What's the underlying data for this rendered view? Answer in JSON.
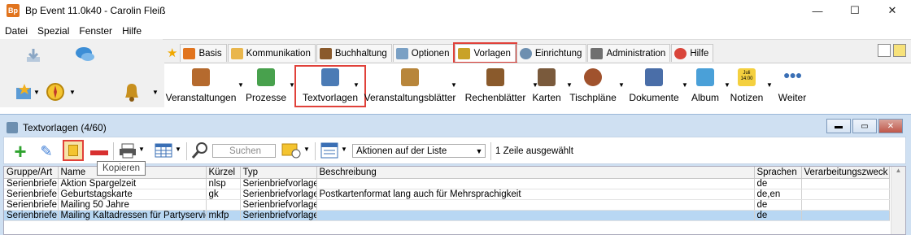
{
  "window": {
    "app_icon_text": "Bp",
    "title": "Bp Event 11.0k40 - Carolin Fleiß",
    "controls": {
      "minimize": "—",
      "maximize": "☐",
      "close": "✕"
    }
  },
  "menu": [
    "Datei",
    "Spezial",
    "Fenster",
    "Hilfe"
  ],
  "ribbon_tabs": [
    {
      "label": "Basis",
      "icon": "bp-icon",
      "color": "#e1741e"
    },
    {
      "label": "Kommunikation",
      "icon": "envelope-icon",
      "color": "#e9b64c"
    },
    {
      "label": "Buchhaltung",
      "icon": "accountant-icon",
      "color": "#8a5a2c"
    },
    {
      "label": "Optionen",
      "icon": "window-icon",
      "color": "#7aa0c4"
    },
    {
      "label": "Vorlagen",
      "icon": "template-icon",
      "color": "#c9a227",
      "active": true
    },
    {
      "label": "Einrichtung",
      "icon": "gear-icon",
      "color": "#6d8fb0"
    },
    {
      "label": "Administration",
      "icon": "tools-icon",
      "color": "#707070"
    },
    {
      "label": "Hilfe",
      "icon": "lifebuoy-icon",
      "color": "#d9453a"
    }
  ],
  "ribbon_tools": [
    {
      "label": "Veranstaltungen",
      "icon": "event-icon",
      "color": "#b56a2e"
    },
    {
      "label": "Prozesse",
      "icon": "process-icon",
      "color": "#48a14d"
    },
    {
      "label": "Textvorlagen",
      "icon": "text-template-icon",
      "color": "#4b7bb5",
      "selected": true
    },
    {
      "label": "Veranstaltungsblätter",
      "icon": "event-sheet-icon",
      "color": "#b8863b"
    },
    {
      "label": "Rechenblätter",
      "icon": "calc-sheet-icon",
      "color": "#8a5a2c"
    },
    {
      "label": "Karten",
      "icon": "cards-icon",
      "color": "#7a5a3c"
    },
    {
      "label": "Tischpläne",
      "icon": "table-plan-icon",
      "color": "#a0522d"
    },
    {
      "label": "Dokumente",
      "icon": "documents-icon",
      "color": "#4a6ea8"
    },
    {
      "label": "Album",
      "icon": "album-icon",
      "color": "#4aa0d8"
    },
    {
      "label": "Notizen",
      "icon": "notes-icon",
      "color": "#f4d03f"
    },
    {
      "label": "Weiter",
      "icon": "more-icon",
      "color": "#3a6fb5"
    }
  ],
  "notes_icon_text": "Juli 14:00",
  "subwindow": {
    "title": "Textvorlagen (4/60)",
    "search_placeholder": "Suchen",
    "actions_combo": "Aktionen auf der Liste",
    "selection_status": "1 Zeile ausgewählt",
    "tooltip": "Kopieren"
  },
  "table": {
    "columns": [
      "Gruppe/Art",
      "Name",
      "Kürzel",
      "Typ",
      "Beschreibung",
      "Sprachen",
      "Verarbeitungszweck"
    ],
    "rows": [
      [
        "Serienbriefe",
        "Aktion Spargelzeit",
        "nlsp",
        "Serienbriefvorlage",
        "",
        "de",
        ""
      ],
      [
        "Serienbriefe",
        "Geburtstagskarte",
        "gk",
        "Serienbriefvorlage",
        "Postkartenformat lang auch für Mehrsprachigkeit",
        "de,en",
        ""
      ],
      [
        "Serienbriefe",
        "Mailing 50 Jahre",
        "",
        "Serienbriefvorlage",
        "",
        "de",
        ""
      ],
      [
        "Serienbriefe",
        "Mailing Kaltadressen für Partyservice",
        "mkfp",
        "Serienbriefvorlage",
        "",
        "de",
        ""
      ]
    ],
    "selected_row": 3
  }
}
